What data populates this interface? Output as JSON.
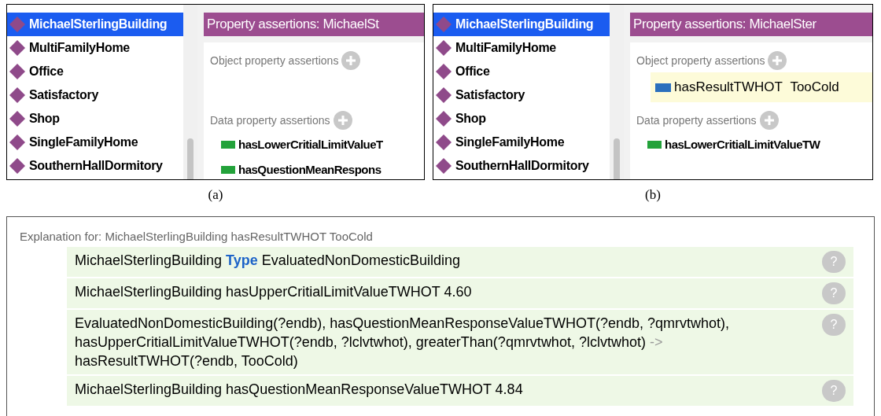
{
  "panels": [
    {
      "caption": "(a)",
      "individuals": [
        {
          "name": "MichaelSterlingBuilding",
          "selected": true
        },
        {
          "name": "MultiFamilyHome",
          "selected": false
        },
        {
          "name": "Office",
          "selected": false
        },
        {
          "name": "Satisfactory",
          "selected": false
        },
        {
          "name": "Shop",
          "selected": false
        },
        {
          "name": "SingleFamilyHome",
          "selected": false
        },
        {
          "name": "SouthernHallDormitory",
          "selected": false
        }
      ],
      "header": "Property assertions: MichaelSt",
      "object_section": "Object property assertions",
      "data_section": "Data property assertions",
      "data_assertions": [
        "hasLowerCritialLimitValueT",
        "hasQuestionMeanRespons"
      ]
    },
    {
      "caption": "(b)",
      "individuals": [
        {
          "name": "MichaelSterlingBuilding",
          "selected": true
        },
        {
          "name": "MultiFamilyHome",
          "selected": false
        },
        {
          "name": "Office",
          "selected": false
        },
        {
          "name": "Satisfactory",
          "selected": false
        },
        {
          "name": "Shop",
          "selected": false
        },
        {
          "name": "SingleFamilyHome",
          "selected": false
        },
        {
          "name": "SouthernHallDormitory",
          "selected": false
        }
      ],
      "header": "Property assertions: MichaelSter",
      "object_section": "Object property assertions",
      "object_assertions": [
        {
          "property": "hasResultTWHOT",
          "value": "TooCold"
        }
      ],
      "data_section": "Data property assertions",
      "data_assertions": [
        "hasLowerCritialLimitValueTW"
      ]
    }
  ],
  "explanation": {
    "title": "Explanation for: MichaelSterlingBuilding hasResultTWHOT TooCold",
    "rows": [
      {
        "help": "?",
        "segments": [
          {
            "kind": "plain",
            "text": "MichaelSterlingBuilding "
          },
          {
            "kind": "keyword",
            "text": "Type"
          },
          {
            "kind": "plain",
            "text": " EvaluatedNonDomesticBuilding"
          }
        ]
      },
      {
        "help": "?",
        "segments": [
          {
            "kind": "plain",
            "text": "MichaelSterlingBuilding hasUpperCritialLimitValueTWHOT 4.60"
          }
        ]
      },
      {
        "help": "?",
        "segments": [
          {
            "kind": "plain",
            "text": "EvaluatedNonDomesticBuilding(?endb), hasQuestionMeanResponseValueTWHOT(?endb, ?qmrvtwhot), hasUpperCritialLimitValueTWHOT(?endb, ?lclvtwhot), greaterThan(?qmrvtwhot, ?lclvtwhot) "
          },
          {
            "kind": "operator",
            "text": "->"
          },
          {
            "kind": "plain",
            "text": " hasResultTWHOT(?endb, TooCold)"
          }
        ]
      },
      {
        "help": "?",
        "segments": [
          {
            "kind": "plain",
            "text": "MichaelSterlingBuilding hasQuestionMeanResponseValueTWHOT 4.84"
          }
        ]
      }
    ]
  }
}
